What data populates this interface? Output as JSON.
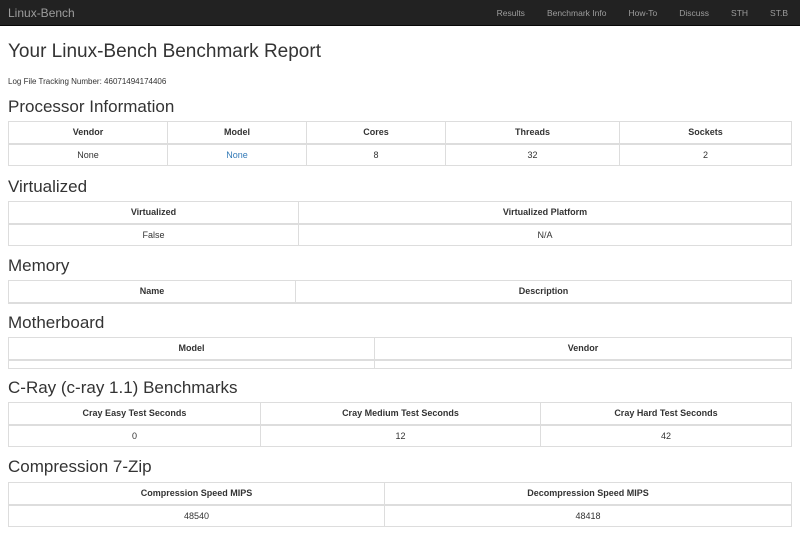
{
  "nav": {
    "brand": "Linux-Bench",
    "links": [
      "Results",
      "Benchmark Info",
      "How-To",
      "Discuss",
      "STH",
      "ST.B"
    ]
  },
  "title": "Your Linux-Bench Benchmark Report",
  "tracking": "Log File Tracking Number: 46071494174406",
  "processor": {
    "heading": "Processor Information",
    "headers": [
      "Vendor",
      "Model",
      "Cores",
      "Threads",
      "Sockets"
    ],
    "values": [
      "None",
      "None",
      "8",
      "32",
      "2"
    ]
  },
  "virtualized": {
    "heading": "Virtualized",
    "headers": [
      "Virtualized",
      "Virtualized Platform"
    ],
    "values": [
      "False",
      "N/A"
    ]
  },
  "memory": {
    "heading": "Memory",
    "headers": [
      "Name",
      "Description"
    ]
  },
  "motherboard": {
    "heading": "Motherboard",
    "headers": [
      "Model",
      "Vendor"
    ]
  },
  "cray": {
    "heading": "C-Ray (c-ray 1.1) Benchmarks",
    "headers": [
      "Cray Easy Test Seconds",
      "Cray Medium Test Seconds",
      "Cray Hard Test Seconds"
    ],
    "values": [
      "0",
      "12",
      "42"
    ]
  },
  "zip": {
    "heading": "Compression 7-Zip",
    "headers": [
      "Compression Speed MIPS",
      "Decompression Speed MIPS"
    ],
    "values": [
      "48540",
      "48418"
    ]
  }
}
